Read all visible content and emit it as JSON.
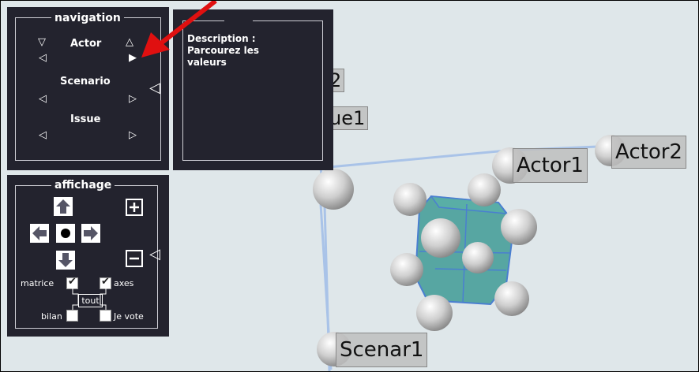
{
  "navigation": {
    "title": "navigation",
    "actor_label": "Actor",
    "scenario_label": "Scenario",
    "issue_label": "Issue"
  },
  "description": {
    "title": "Description :",
    "text_line1": "Parcourez les",
    "text_line2": "valeurs"
  },
  "affichage": {
    "title": "affichage",
    "matrice_label": "matrice",
    "axes_label": "axes",
    "tout_label": "tout",
    "bilan_label": "bilan",
    "je_vote_label": "Je vote",
    "matrice_checked": true,
    "axes_checked": true,
    "bilan_checked": false,
    "je_vote_checked": false
  },
  "scene_labels": {
    "partial_top": "2",
    "issue1": "ue1",
    "actor1": "Actor1",
    "actor2": "Actor2",
    "scenar1": "Scenar1"
  },
  "annotation": {
    "arrow_color": "#e01010"
  },
  "colors": {
    "panel_bg": "#23232e",
    "scene_bg": "#dfe7ea",
    "cube_fill": "#3f9a95"
  }
}
